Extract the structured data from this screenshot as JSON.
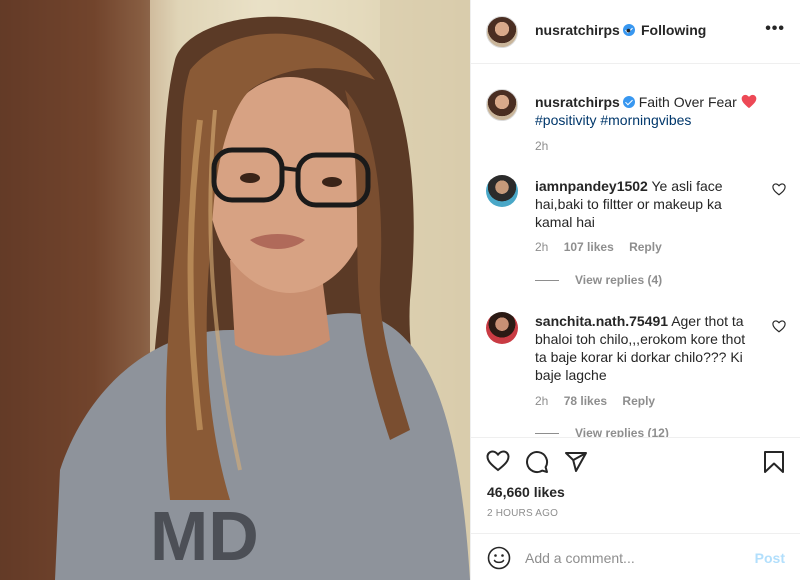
{
  "post": {
    "username": "nusratchirps",
    "follow_status": "Following",
    "separator": "•",
    "more_glyph": "•••",
    "caption_text": "Faith Over Fear",
    "hashtags": "#positivity #morningvibes",
    "caption_time": "2h",
    "likes": "46,660 likes",
    "posted": "2 HOURS AGO"
  },
  "comments": [
    {
      "username": "iamnpandey1502",
      "text": "Ye asli face hai,baki to filtter or makeup ka kamal hai",
      "time": "2h",
      "likes": "107 likes",
      "reply": "Reply",
      "view_replies": "View replies (4)"
    },
    {
      "username": "sanchita.nath.75491",
      "text": "Ager thot ta bhaloi toh chilo,,,erokom kore thot ta baje korar ki dorkar chilo??? Ki baje lagche",
      "time": "2h",
      "likes": "78 likes",
      "reply": "Reply",
      "view_replies": "View replies (12)"
    }
  ],
  "add_comment": {
    "placeholder": "Add a comment...",
    "post_label": "Post"
  },
  "colors": {
    "link": "#00376b",
    "verified": "#3897f0",
    "heart_red": "#ed4956",
    "post_disabled": "#b2dffc"
  },
  "icons": [
    "verified-badge-icon",
    "red-heart-icon",
    "like-heart-icon",
    "comment-icon",
    "share-icon",
    "bookmark-icon",
    "emoji-icon",
    "more-options-icon"
  ]
}
